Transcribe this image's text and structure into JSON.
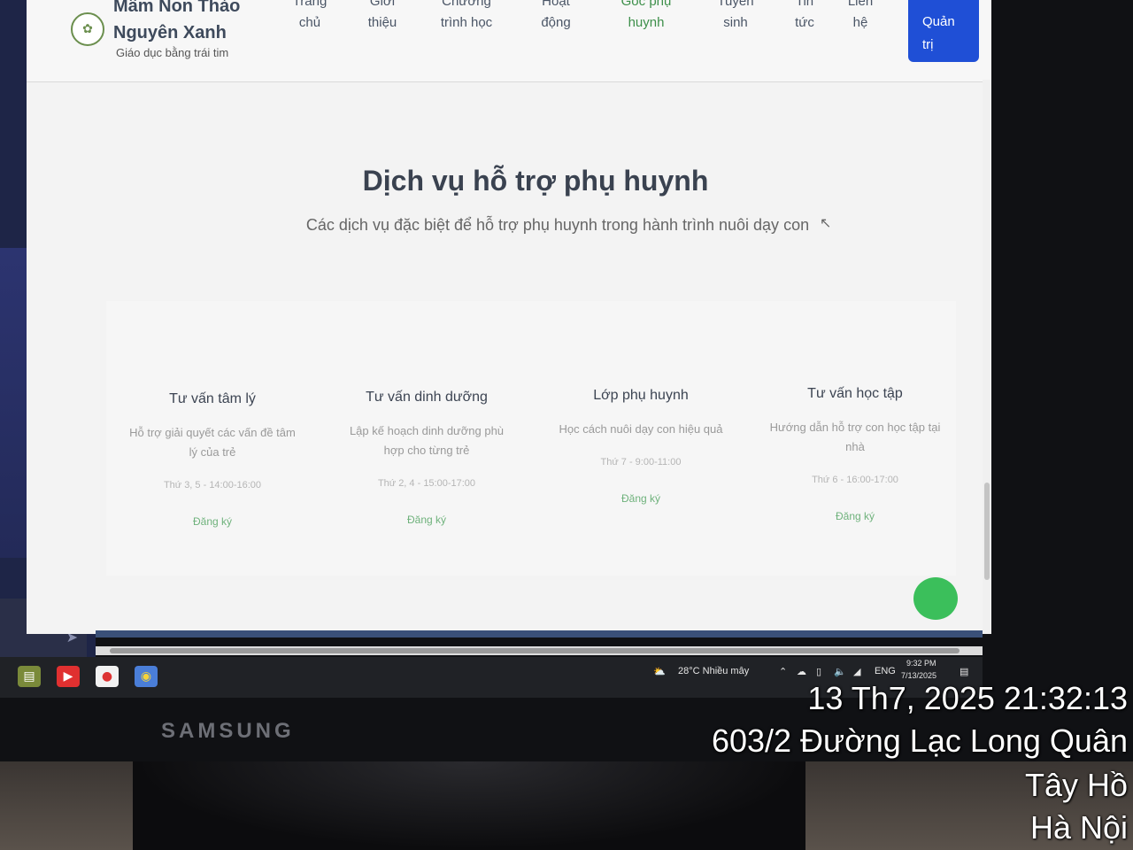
{
  "site": {
    "name": "Mầm Non Thảo Nguyên Xanh",
    "slogan": "Giáo dục bằng trái tim"
  },
  "nav": {
    "items": [
      {
        "label": "Trang chủ"
      },
      {
        "label": "Giới thiệu"
      },
      {
        "label": "Chương trình học"
      },
      {
        "label": "Hoạt động"
      },
      {
        "label": "Góc phụ huynh"
      },
      {
        "label": "Tuyển sinh"
      },
      {
        "label": "Tin tức"
      },
      {
        "label": "Liên hệ"
      }
    ],
    "admin_label": "Quản trị"
  },
  "section": {
    "title": "Dịch vụ hỗ trợ phụ huynh",
    "subtitle": "Các dịch vụ đặc biệt để hỗ trợ phụ huynh trong hành trình nuôi dạy con"
  },
  "services": [
    {
      "title": "Tư vấn tâm lý",
      "desc": "Hỗ trợ giải quyết các vấn đề tâm lý của trẻ",
      "time": "Thứ 3, 5 - 14:00-16:00",
      "action": "Đăng ký"
    },
    {
      "title": "Tư vấn dinh dưỡng",
      "desc": "Lập kế hoạch dinh dưỡng phù hợp cho từng trẻ",
      "time": "Thứ 2, 4 - 15:00-17:00",
      "action": "Đăng ký"
    },
    {
      "title": "Lớp phụ huynh",
      "desc": "Học cách nuôi dạy con hiệu quả",
      "time": "Thứ 7 - 9:00-11:00",
      "action": "Đăng ký"
    },
    {
      "title": "Tư vấn học tập",
      "desc": "Hướng dẫn hỗ trợ con học tập tại nhà",
      "time": "Thứ 6 - 16:00-17:00",
      "action": "Đăng ký"
    }
  ],
  "taskbar": {
    "weather": "28°C Nhiều mây",
    "lang": "ENG",
    "time": "9:32 PM",
    "date": "7/13/2025"
  },
  "monitor": {
    "brand": "SAMSUNG"
  },
  "stamp": {
    "datetime": "13 Th7, 2025 21:32:13",
    "address": "603/2 Đường Lạc Long Quân",
    "district": "Tây Hồ",
    "city": "Hà Nội"
  },
  "colors": {
    "accent_green": "#3d8f4a",
    "admin_blue": "#1f4fd6",
    "fab_green": "#3bbf5b"
  }
}
